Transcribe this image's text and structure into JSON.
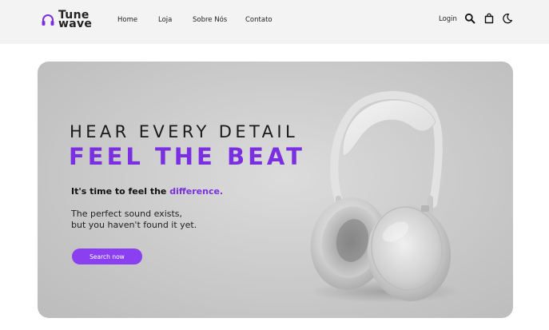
{
  "brand": {
    "line1": "Tune",
    "line2": "wave",
    "accent_color": "#7a2fe0"
  },
  "nav": {
    "items": [
      {
        "label": "Home"
      },
      {
        "label": "Loja"
      },
      {
        "label": "Sobre Nós"
      },
      {
        "label": "Contato"
      }
    ],
    "login_label": "Login",
    "icons": [
      "search-icon",
      "shopping-bag-icon",
      "moon-icon"
    ]
  },
  "hero": {
    "line1": "HEAR EVERY DETAIL",
    "line2": "FEEL THE BEAT",
    "tagline_prefix": "It's time to feel the ",
    "tagline_accent": "difference.",
    "desc_line1": "The perfect sound exists,",
    "desc_line2": "but you haven't found it yet.",
    "cta_label": "Search now",
    "cta_color": "#8a3ff0",
    "image": "headphones-product"
  }
}
